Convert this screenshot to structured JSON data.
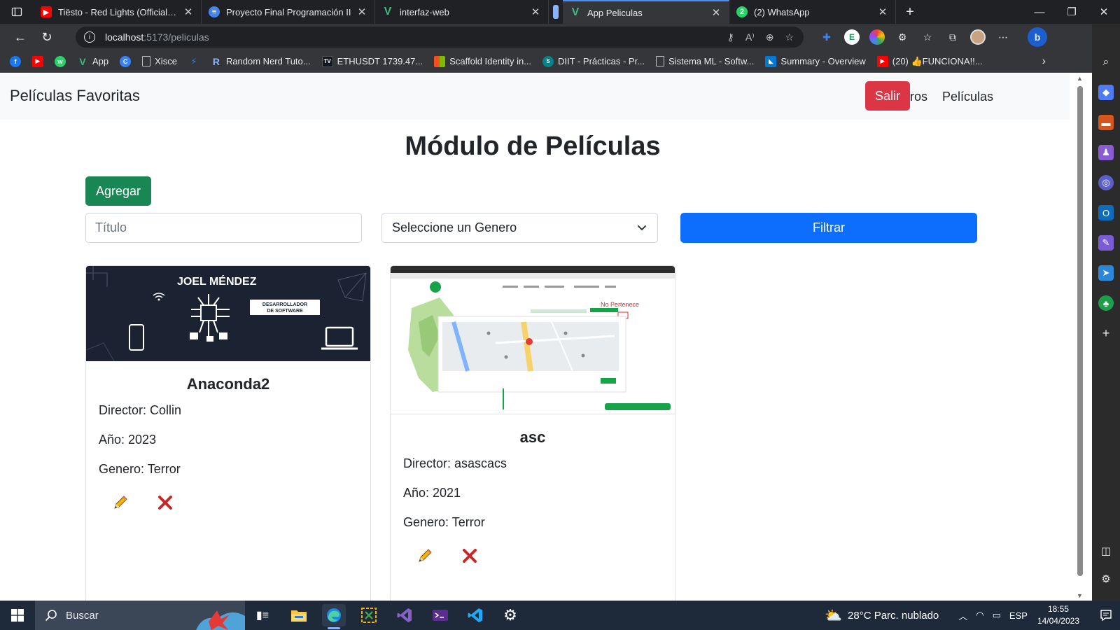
{
  "browser": {
    "tabs": [
      {
        "title": "Tiësto - Red Lights (Official Video",
        "favicon": "youtube-icon",
        "favicon_color": "#ff0000"
      },
      {
        "title": "Proyecto Final Programación II",
        "favicon": "docs-icon",
        "favicon_color": "#4285f4"
      },
      {
        "title": "interfaz-web",
        "favicon": "vue-icon",
        "favicon_color": "#41b883"
      },
      {
        "title": "App Peliculas",
        "favicon": "vue-icon",
        "favicon_color": "#41b883",
        "active": true
      },
      {
        "title": "(2) WhatsApp",
        "favicon": "whatsapp-icon",
        "favicon_color": "#25d366",
        "badge": "2"
      }
    ],
    "url_host": "localhost",
    "url_path": ":5173/peliculas",
    "bookmarks": [
      {
        "label": "",
        "icon": "facebook-icon",
        "color": "#1877f2"
      },
      {
        "label": "",
        "icon": "youtube-icon",
        "color": "#ff0000"
      },
      {
        "label": "",
        "icon": "whatsapp-icon",
        "color": "#25d366"
      },
      {
        "label": "App",
        "icon": "vue-icon",
        "color": "#41b883"
      },
      {
        "label": "",
        "icon": "c-icon",
        "color": "#3b82f6"
      },
      {
        "label": "Xisce",
        "icon": "page-icon",
        "color": "#9aa0a6"
      },
      {
        "label": "",
        "icon": "bolt-icon",
        "color": "#2b7de9"
      },
      {
        "label": "Random Nerd Tuto...",
        "icon": "r-icon",
        "color": "#1e40af"
      },
      {
        "label": "ETHUSDT 1739.47...",
        "icon": "tradingview-icon",
        "color": "#131722"
      },
      {
        "label": "Scaffold Identity in...",
        "icon": "microsoft-icon",
        "color": "#f25022"
      },
      {
        "label": "DIIT - Prácticas - Pr...",
        "icon": "sharepoint-icon",
        "color": "#038387"
      },
      {
        "label": "Sistema ML - Softw...",
        "icon": "page-icon",
        "color": "#9aa0a6"
      },
      {
        "label": "Summary - Overview",
        "icon": "azure-devops-icon",
        "color": "#0078d4"
      },
      {
        "label": "(20) 👍FUNCIONA!!...",
        "icon": "youtube-icon",
        "color": "#ff0000"
      }
    ]
  },
  "app": {
    "brand": "Películas Favoritas",
    "nav": {
      "generos": "Generos",
      "peliculas": "Películas",
      "salir": "Salir"
    },
    "title": "Módulo de Películas",
    "add_label": "Agregar",
    "filter": {
      "title_placeholder": "Título",
      "genre_selected": "Seleccione un Genero",
      "filter_label": "Filtrar"
    },
    "movies": [
      {
        "title": "Anaconda2",
        "director": "Director: Collin",
        "year": "Año: 2023",
        "genre": "Genero: Terror",
        "poster_text": "JOEL MÉNDEZ",
        "poster_badge": "DESARROLLADOR DE SOFTWARE"
      },
      {
        "title": "asc",
        "director": "Director: asascacs",
        "year": "Año: 2021",
        "genre": "Genero: Terror",
        "poster_annotation": "No Pertenece"
      }
    ],
    "colors": {
      "danger": "#dc3545",
      "success": "#198754",
      "primary": "#0d6efd"
    }
  },
  "taskbar": {
    "search_label": "Buscar",
    "weather": "28°C  Parc. nublado",
    "language": "ESP",
    "time": "18:55",
    "date": "14/04/2023"
  }
}
